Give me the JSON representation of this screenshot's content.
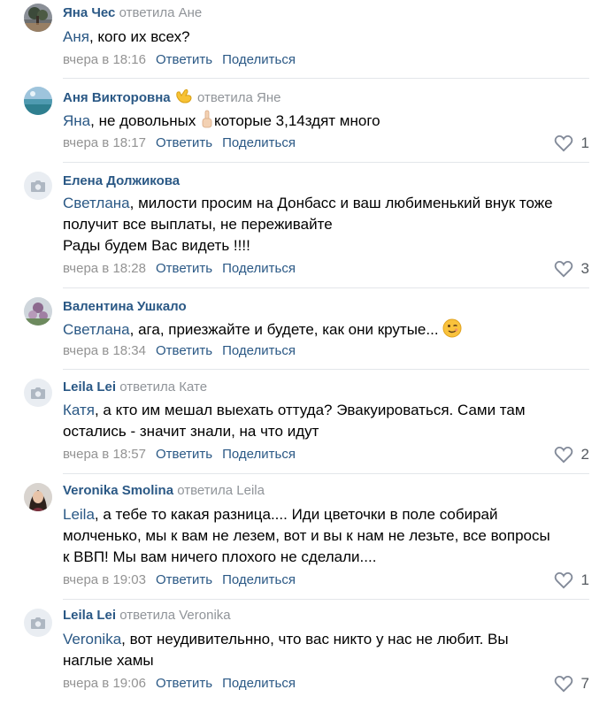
{
  "labels": {
    "reply": "Ответить",
    "share": "Поделиться"
  },
  "comments": [
    {
      "author": "Яна Чес",
      "replied_to": "ответила Ане",
      "mention": "Аня",
      "lines": [
        ", кого их всех?"
      ],
      "time": "вчера в 18:16",
      "likes": "",
      "avatar": "photo-tree"
    },
    {
      "author": "Аня Викторовна",
      "author_emoji": "hand-gesture-icon",
      "replied_to": "ответила Яне",
      "mention": "Яна",
      "lines": [
        ", не довольных ",
        "которые 3,14здят много"
      ],
      "time": "вчера в 18:17",
      "likes": "1",
      "avatar": "photo-sea"
    },
    {
      "author": "Елена Должикова",
      "replied_to": "",
      "mention": "Светлана",
      "lines": [
        ", милости просим на Донбасс и ваш любименький внук тоже",
        "получит все выплаты, не переживайте",
        "Рады будем Вас видеть !!!!"
      ],
      "time": "вчера в 18:28",
      "likes": "3",
      "avatar": "camera-placeholder"
    },
    {
      "author": "Валентина Ушкало",
      "replied_to": "",
      "mention": "Светлана",
      "lines": [
        ", ага, приезжайте и будете, как они крутые... "
      ],
      "time": "вчера в 18:34",
      "likes": "",
      "avatar": "photo-flowers"
    },
    {
      "author": "Leila Lei",
      "replied_to": "ответила Кате",
      "mention": "Катя",
      "lines": [
        ", а кто им мешал выехать оттуда? Эвакуироваться. Сами там",
        "остались - значит знали, на что идут"
      ],
      "time": "вчера в 18:57",
      "likes": "2",
      "avatar": "camera-placeholder"
    },
    {
      "author": "Veronika Smolina",
      "replied_to": "ответила Leila",
      "mention": "Leila",
      "lines": [
        ", а тебе то какая разница.... Иди цветочки в поле собирай",
        "молченько, мы к вам не лезем, вот и вы к нам не лезьте, все вопросы",
        "к ВВП! Мы вам ничего плохого не сделали...."
      ],
      "time": "вчера в 19:03",
      "likes": "1",
      "avatar": "photo-woman"
    },
    {
      "author": "Leila Lei",
      "replied_to": "ответила Veronika",
      "mention": "Veronika",
      "lines": [
        ", вот неудивительнно, что вас никто у нас не любит. Вы",
        "наглые хамы"
      ],
      "time": "вчера в 19:06",
      "likes": "7",
      "avatar": "camera-placeholder"
    }
  ]
}
